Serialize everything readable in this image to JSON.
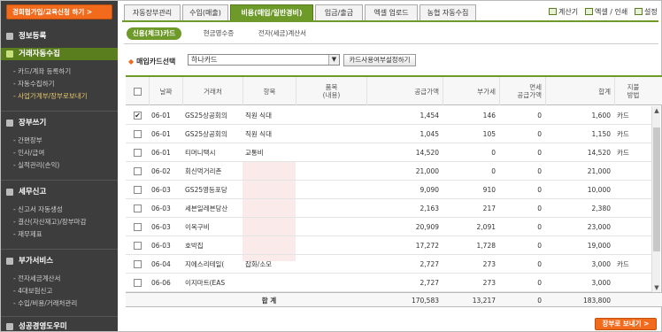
{
  "sidebar": {
    "promo_label": "경희협가입/교육신청 하기 >",
    "sections": [
      {
        "title": "정보등록",
        "active": false
      },
      {
        "title": "거래자동수집",
        "active": true
      },
      {
        "title": "장부쓰기",
        "active": false
      },
      {
        "title": "세무신고",
        "active": false
      },
      {
        "title": "부가서비스",
        "active": false
      },
      {
        "title": "성공경영도우미",
        "active": false
      }
    ],
    "items": {
      "collect": [
        "- 카드/계좌 등록하기",
        "- 자동수집하기",
        "- 사업가계부/장부로보내기"
      ],
      "book": [
        "- 간편장부",
        "- 인사/급여",
        "- 실적관리(손익)"
      ],
      "tax": [
        "- 신고서 자동생성",
        "- 결산(자산재고)/장부마감",
        "- 재무제표"
      ],
      "extra": [
        "- 전자세금계산서",
        "- 4대보험신고",
        "- 수입/비용/거래처관리"
      ]
    }
  },
  "tabs": [
    "자동장부관리",
    "수입(매출)",
    "비용(매입/일반경비)",
    "입금/출금",
    "엑셀 업로드",
    "농협 자동수집"
  ],
  "toplinks": {
    "calc": "계산기",
    "excel": "엑셀 / 인쇄",
    "setting": "설정"
  },
  "subtabs": [
    "신용(체크)카드",
    "현금영수증",
    "전자(세금)계산서"
  ],
  "filter": {
    "label": "매입카드선택",
    "selected": "하나카드",
    "button": "카드사용여부설정하기"
  },
  "table": {
    "headers": {
      "date": "날짜",
      "vendor": "거래처",
      "item": "항목",
      "product": "품목\n(내용)",
      "supply": "공급가액",
      "vat": "부가세",
      "exempt": "면세\n공급가액",
      "total": "합계",
      "pay": "지불\n방법"
    },
    "rows": [
      {
        "checked": true,
        "date": "06-01",
        "vendor": "GS25상공회의",
        "item": "직원 식대",
        "supply": "1,454",
        "vat": "146",
        "exempt": "0",
        "total": "1,600",
        "pay": "카드"
      },
      {
        "checked": false,
        "date": "06-01",
        "vendor": "GS25상공회의",
        "item": "직원 식대",
        "supply": "1,045",
        "vat": "105",
        "exempt": "0",
        "total": "1,150",
        "pay": "카드"
      },
      {
        "checked": false,
        "date": "06-01",
        "vendor": "티머니택시",
        "item": "교통비",
        "supply": "14,520",
        "vat": "0",
        "exempt": "0",
        "total": "14,520",
        "pay": "카드"
      },
      {
        "checked": false,
        "date": "06-02",
        "vendor": "회신먹거리촌",
        "item": "",
        "supply": "21,000",
        "vat": "0",
        "exempt": "0",
        "total": "21,000",
        "pay": ""
      },
      {
        "checked": false,
        "date": "06-03",
        "vendor": "GS25영등포당",
        "item": "",
        "supply": "9,090",
        "vat": "910",
        "exempt": "0",
        "total": "10,000",
        "pay": ""
      },
      {
        "checked": false,
        "date": "06-03",
        "vendor": "세븐일레븐당산",
        "item": "",
        "supply": "2,163",
        "vat": "217",
        "exempt": "0",
        "total": "2,380",
        "pay": ""
      },
      {
        "checked": false,
        "date": "06-03",
        "vendor": "이옥구비",
        "item": "",
        "supply": "20,909",
        "vat": "2,091",
        "exempt": "0",
        "total": "23,000",
        "pay": ""
      },
      {
        "checked": false,
        "date": "06-03",
        "vendor": "호박집",
        "item": "",
        "supply": "17,272",
        "vat": "1,728",
        "exempt": "0",
        "total": "19,000",
        "pay": ""
      },
      {
        "checked": false,
        "date": "06-04",
        "vendor": "지에스리테일(",
        "item": "잡화/소모",
        "supply": "2,727",
        "vat": "273",
        "exempt": "0",
        "total": "3,000",
        "pay": "카드"
      },
      {
        "checked": false,
        "date": "06-06",
        "vendor": "이지마트(EAS",
        "item": "",
        "supply": "2,727",
        "vat": "273",
        "exempt": "0",
        "total": "3,000",
        "pay": ""
      }
    ],
    "totals": {
      "label": "합 계",
      "supply": "170,583",
      "vat": "13,217",
      "exempt": "0",
      "total": "183,800"
    }
  },
  "send_button": "장부로 보내기 >"
}
